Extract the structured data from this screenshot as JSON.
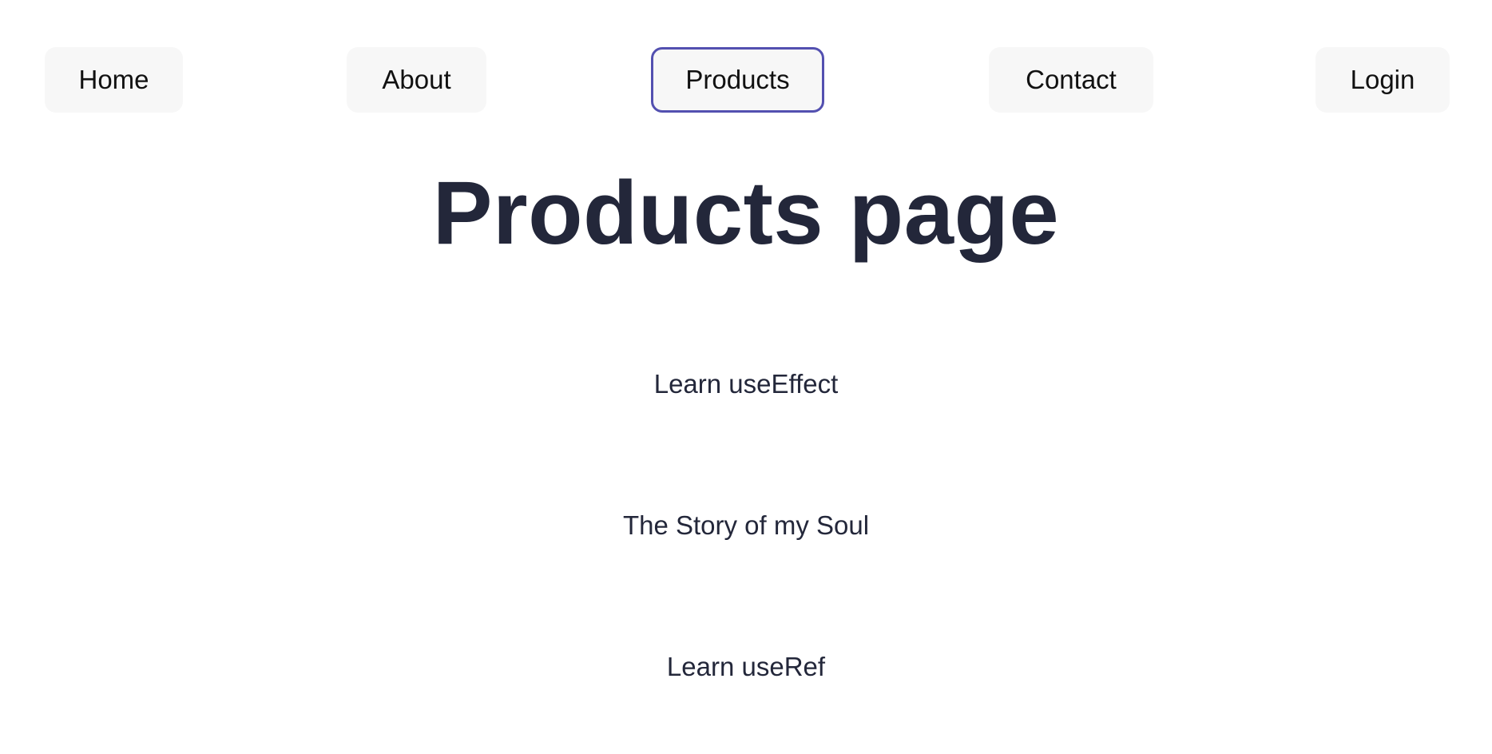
{
  "nav": {
    "items": [
      {
        "label": "Home"
      },
      {
        "label": "About"
      },
      {
        "label": "Products",
        "active": true
      },
      {
        "label": "Contact"
      },
      {
        "label": "Login"
      }
    ]
  },
  "main": {
    "title": "Products page",
    "products": [
      {
        "name": "Learn useEffect"
      },
      {
        "name": "The Story of my Soul"
      },
      {
        "name": "Learn useRef"
      }
    ]
  },
  "colors": {
    "active_border": "#5350b0",
    "button_background": "#f7f7f7",
    "heading_text": "#23273a",
    "page_background": "#ffffff"
  }
}
